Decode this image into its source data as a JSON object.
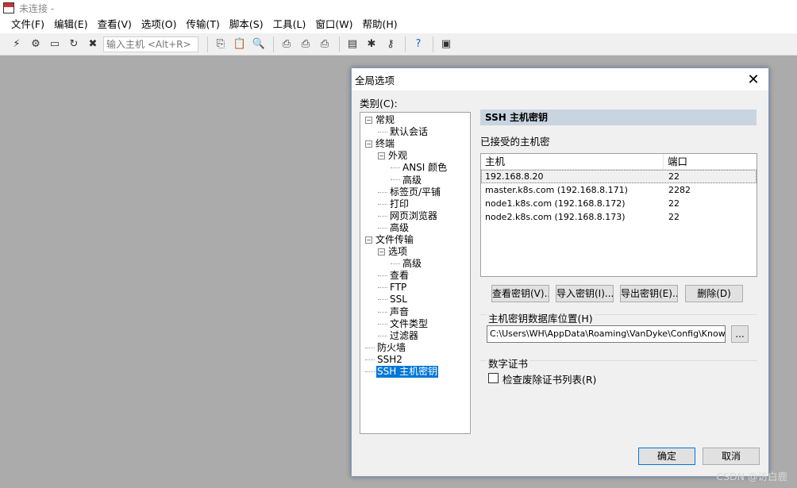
{
  "window": {
    "title": "未连接 -"
  },
  "menu": [
    "文件(F)",
    "编辑(E)",
    "查看(V)",
    "选项(O)",
    "传输(T)",
    "脚本(S)",
    "工具(L)",
    "窗口(W)",
    "帮助(H)"
  ],
  "toolbar": {
    "host_placeholder": "输入主机 <Alt+R>"
  },
  "dialog": {
    "title": "全局选项",
    "category_label": "类别(C):",
    "tree": [
      {
        "label": "常规",
        "level": 0,
        "expander": "−"
      },
      {
        "label": "默认会话",
        "level": 1
      },
      {
        "label": "终端",
        "level": 0,
        "expander": "−"
      },
      {
        "label": "外观",
        "level": 1,
        "expander": "−"
      },
      {
        "label": "ANSI 颜色",
        "level": 2
      },
      {
        "label": "高级",
        "level": 2
      },
      {
        "label": "标签页/平铺",
        "level": 1
      },
      {
        "label": "打印",
        "level": 1
      },
      {
        "label": "网页浏览器",
        "level": 1
      },
      {
        "label": "高级",
        "level": 1
      },
      {
        "label": "文件传输",
        "level": 0,
        "expander": "−"
      },
      {
        "label": "选项",
        "level": 1,
        "expander": "−"
      },
      {
        "label": "高级",
        "level": 2
      },
      {
        "label": "查看",
        "level": 1
      },
      {
        "label": "FTP",
        "level": 1
      },
      {
        "label": "SSL",
        "level": 1
      },
      {
        "label": "声音",
        "level": 1
      },
      {
        "label": "文件类型",
        "level": 1
      },
      {
        "label": "过滤器",
        "level": 1
      },
      {
        "label": "防火墙",
        "level": 0
      },
      {
        "label": "SSH2",
        "level": 0
      },
      {
        "label": "SSH 主机密钥",
        "level": 0,
        "selected": true
      }
    ],
    "section_title": "SSH 主机密钥",
    "accepted_label": "已接受的主机密",
    "keys": {
      "headers": [
        "主机",
        "端口"
      ],
      "rows": [
        {
          "host": "192.168.8.20",
          "port": "22"
        },
        {
          "host": "master.k8s.com (192.168.8.171)",
          "port": "2282"
        },
        {
          "host": "node1.k8s.com (192.168.8.172)",
          "port": "22"
        },
        {
          "host": "node2.k8s.com (192.168.8.173)",
          "port": "22"
        }
      ]
    },
    "buttons": {
      "view": "查看密钥(V)..",
      "import": "导入密钥(I)...",
      "export": "导出密钥(E)..",
      "delete": "删除(D)",
      "browse": "...",
      "ok": "确定",
      "cancel": "取消"
    },
    "db_group": {
      "label": "主机密钥数据库位置(H)",
      "path": "C:\\Users\\WH\\AppData\\Roaming\\VanDyke\\Config\\KnownHosts"
    },
    "cert_group": {
      "label": "数字证书",
      "checkbox_label": "检查废除证书列表(R)",
      "checked": false
    }
  },
  "watermark": "CSDN @访白鹿"
}
